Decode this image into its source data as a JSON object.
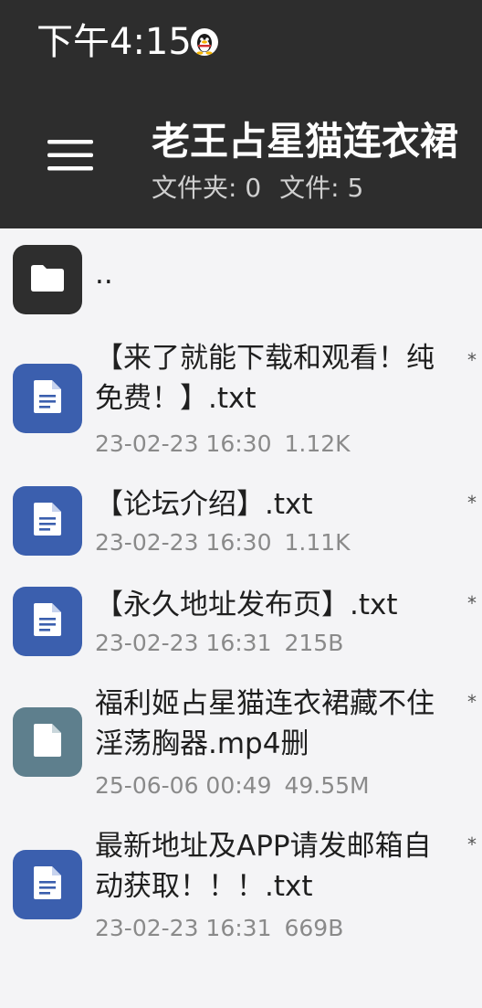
{
  "status_bar": {
    "time": "下午4:15",
    "notification_icon": "qq-penguin-icon"
  },
  "app_bar": {
    "menu_icon": "hamburger-menu-icon",
    "title": "老王占星猫连衣裙",
    "subtitle_folders": "文件夹: 0",
    "subtitle_files": "文件: 5"
  },
  "list": {
    "parent": {
      "name": "..",
      "icon": "folder-icon"
    },
    "items": [
      {
        "name": "【来了就能下载和观看！纯免费！】.txt",
        "date": "23-02-23 16:30",
        "size": "1.12K",
        "icon": "document-icon",
        "mark": "*"
      },
      {
        "name": "【论坛介绍】.txt",
        "date": "23-02-23 16:30",
        "size": "1.11K",
        "icon": "document-icon",
        "mark": "*"
      },
      {
        "name": "【永久地址发布页】.txt",
        "date": "23-02-23 16:31",
        "size": "215B",
        "icon": "document-icon",
        "mark": "*"
      },
      {
        "name": "福利姬占星猫连衣裙藏不住淫荡胸器.mp4删",
        "date": "25-06-06 00:49",
        "size": "49.55M",
        "icon": "file-icon",
        "mark": "*"
      },
      {
        "name": "最新地址及APP请发邮箱自动获取！！！.txt",
        "date": "23-02-23 16:31",
        "size": "669B",
        "icon": "document-icon",
        "mark": "*"
      }
    ]
  },
  "colors": {
    "app_bar": "#2d2d2d",
    "background": "#f4f4f6",
    "doc_tile": "#3b5fae",
    "file_tile": "#5e7f8d",
    "folder_tile": "#2e2e2e"
  }
}
